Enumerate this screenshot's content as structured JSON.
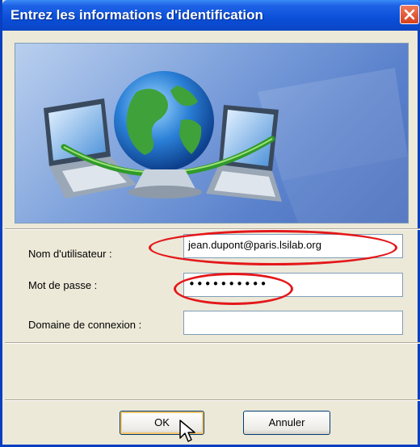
{
  "window": {
    "title": "Entrez les informations d'identification"
  },
  "form": {
    "username_label": "Nom d'utilisateur :",
    "username_value": "jean.dupont@paris.lsilab.org",
    "password_label": "Mot de passe :",
    "password_value": "••••••••••",
    "domain_label": "Domaine de connexion :",
    "domain_value": ""
  },
  "buttons": {
    "ok": "OK",
    "cancel": "Annuler"
  },
  "icons": [
    "close-icon",
    "globe-network-icon",
    "laptop-icon",
    "mouse-cursor-icon"
  ],
  "colors": {
    "titlebar": "#0a4fd8",
    "highlight": "#e4171a",
    "dialog_bg": "#ece9d8"
  }
}
